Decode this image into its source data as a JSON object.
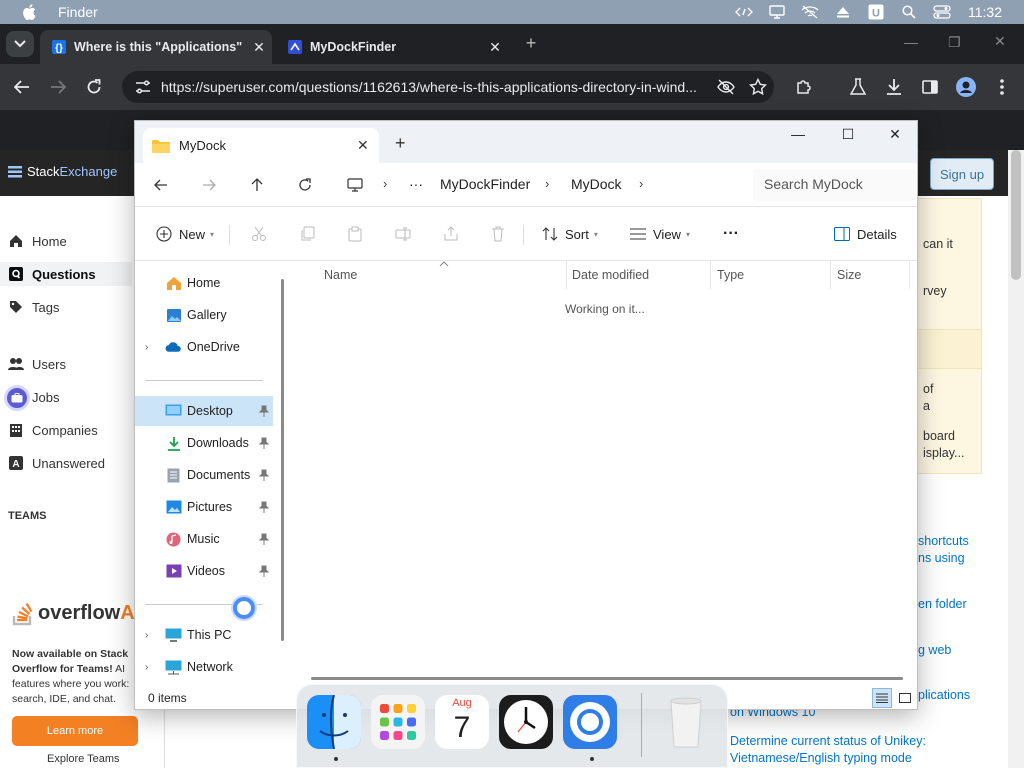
{
  "menubar": {
    "app_name": "Finder",
    "clock": "11:32"
  },
  "chrome": {
    "tabs": [
      {
        "title": "Where is this \"Applications\" Di",
        "close": "✕"
      },
      {
        "title": "MyDockFinder",
        "close": "✕"
      }
    ],
    "new_tab": "+",
    "url": "https://superuser.com/questions/1162613/where-is-this-applications-directory-in-wind..."
  },
  "stackexchange": {
    "logo_a": "Stack",
    "logo_b": "Exchange",
    "signup": "Sign up",
    "nav": [
      "Home",
      "Questions",
      "Tags",
      "Users",
      "Jobs",
      "Companies",
      "Unanswered"
    ],
    "teams_heading": "TEAMS",
    "overflow": "overflow",
    "ai": "AI",
    "teams_text_bold": "Now available on Stack Overflow for Teams!",
    "teams_text": " AI features where you work: search, IDE, and chat.",
    "learn_more": "Learn more",
    "explore_teams": "Explore Teams",
    "right_fragments": [
      "can it",
      "rvey",
      "of",
      "a",
      "board",
      "isplay..."
    ],
    "right_links": [
      "shortcuts",
      "ns using",
      "en folder",
      "g web",
      "plications",
      "on Windows 10",
      "Determine current status of Unikey:",
      "Vietnamese/English typing mode"
    ]
  },
  "explorer": {
    "tab_title": "MyDock",
    "breadcrumb": [
      "MyDockFinder",
      "MyDock"
    ],
    "more_crumb": "···",
    "search_placeholder": "Search MyDock",
    "commands": {
      "new": "New",
      "sort": "Sort",
      "view": "View",
      "more": "···",
      "details": "Details"
    },
    "nav": {
      "home": "Home",
      "gallery": "Gallery",
      "onedrive": "OneDrive",
      "desktop": "Desktop",
      "downloads": "Downloads",
      "documents": "Documents",
      "pictures": "Pictures",
      "music": "Music",
      "videos": "Videos",
      "this_pc": "This PC",
      "network": "Network"
    },
    "columns": [
      "Name",
      "Date modified",
      "Type",
      "Size"
    ],
    "status_message": "Working on it...",
    "items_count": "0 items"
  },
  "dock": {
    "calendar_month": "Aug",
    "calendar_day": "7"
  },
  "colors": {
    "accent": "#0067c0",
    "selection": "#cce4f7",
    "se_orange": "#f48024"
  }
}
